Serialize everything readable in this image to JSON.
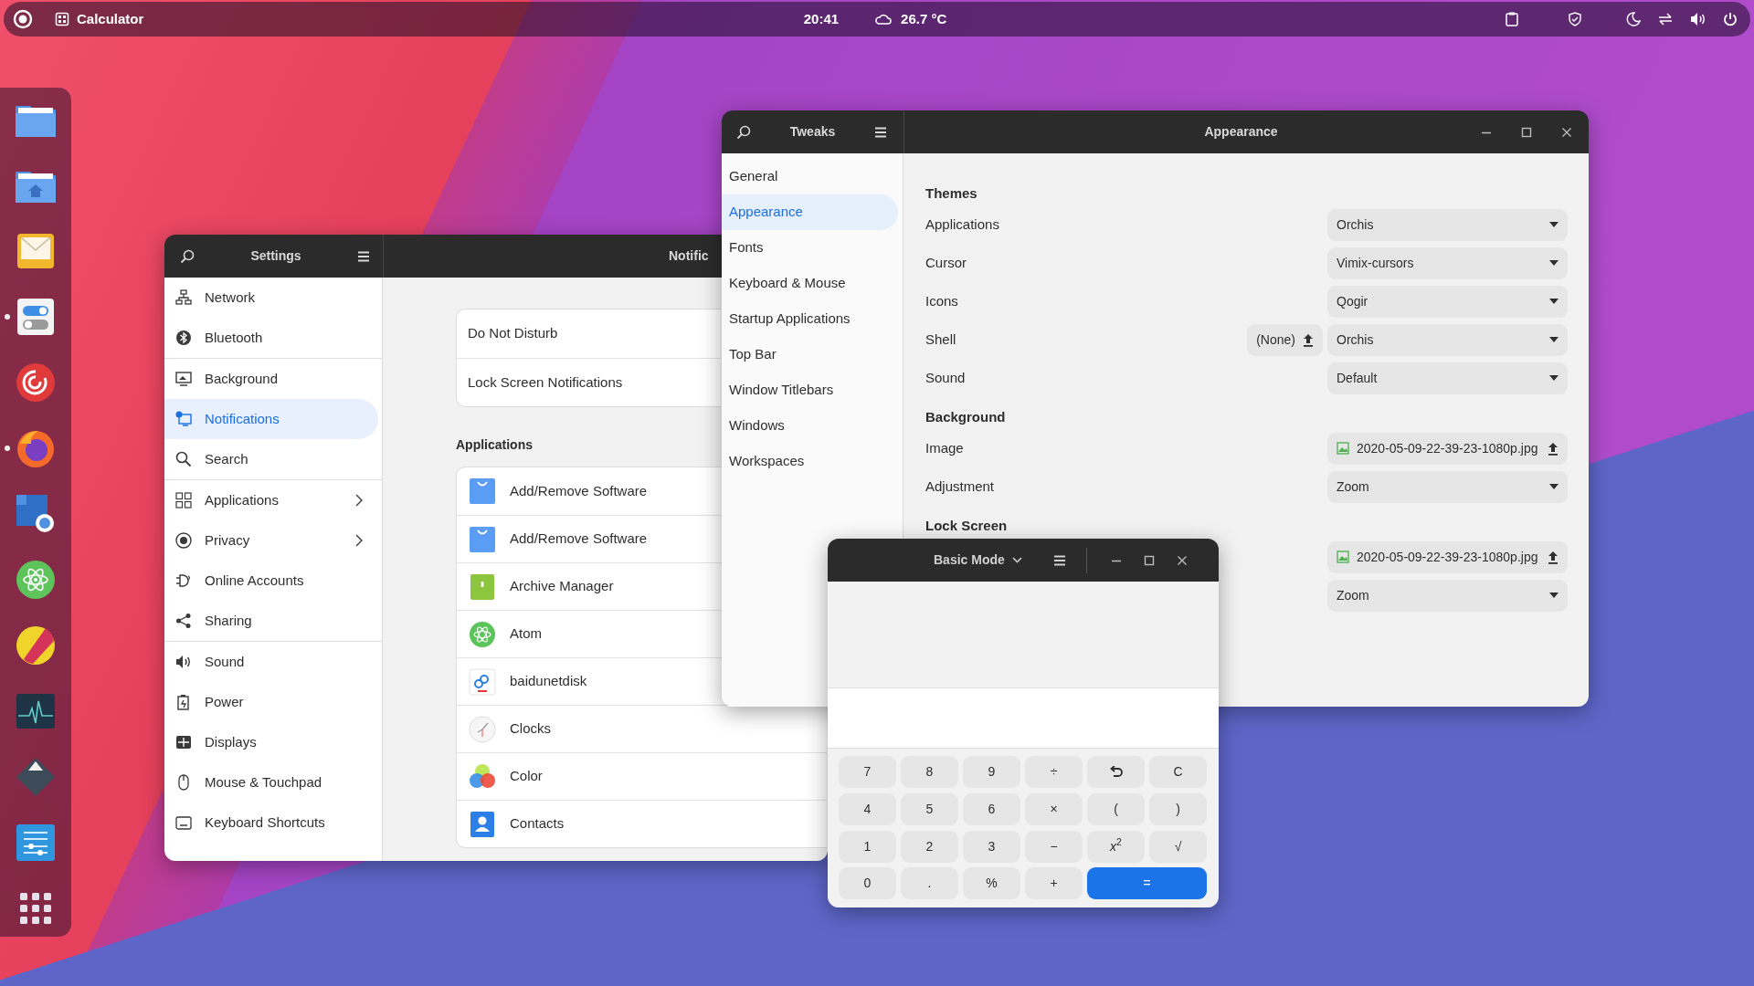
{
  "top_bar": {
    "app_name": "Calculator",
    "clock": "20:41",
    "weather": "26.7 °C"
  },
  "dock": {
    "items": [
      {
        "running": false
      },
      {
        "running": false
      },
      {
        "running": false
      },
      {
        "running": true
      },
      {
        "running": false
      },
      {
        "running": true
      },
      {
        "running": false
      },
      {
        "running": false
      },
      {
        "running": false
      },
      {
        "running": false
      },
      {
        "running": false
      },
      {
        "running": false
      }
    ]
  },
  "settings": {
    "title": "Settings",
    "page_title": "Notific",
    "sidebar": {
      "groups": [
        [
          {
            "label": "Network",
            "selected": false,
            "submenu": false
          },
          {
            "label": "Bluetooth",
            "selected": false,
            "submenu": false
          }
        ],
        [
          {
            "label": "Background",
            "selected": false,
            "submenu": false
          },
          {
            "label": "Notifications",
            "selected": true,
            "submenu": false
          },
          {
            "label": "Search",
            "selected": false,
            "submenu": false
          }
        ],
        [
          {
            "label": "Applications",
            "selected": false,
            "submenu": true
          },
          {
            "label": "Privacy",
            "selected": false,
            "submenu": true
          },
          {
            "label": "Online Accounts",
            "selected": false,
            "submenu": false
          },
          {
            "label": "Sharing",
            "selected": false,
            "submenu": false
          }
        ],
        [
          {
            "label": "Sound",
            "selected": false,
            "submenu": false
          },
          {
            "label": "Power",
            "selected": false,
            "submenu": false
          },
          {
            "label": "Displays",
            "selected": false,
            "submenu": false
          },
          {
            "label": "Mouse & Touchpad",
            "selected": false,
            "submenu": false
          },
          {
            "label": "Keyboard Shortcuts",
            "selected": false,
            "submenu": false
          }
        ]
      ]
    },
    "general_rows": [
      "Do Not Disturb",
      "Lock Screen Notifications"
    ],
    "applications_heading": "Applications",
    "applications": [
      "Add/Remove Software",
      "Add/Remove Software",
      "Archive Manager",
      "Atom",
      "baidunetdisk",
      "Clocks",
      "Color",
      "Contacts"
    ]
  },
  "tweaks": {
    "title": "Tweaks",
    "page_title": "Appearance",
    "sidebar": [
      {
        "label": "General",
        "selected": false
      },
      {
        "label": "Appearance",
        "selected": true
      },
      {
        "label": "Fonts",
        "selected": false
      },
      {
        "label": "Keyboard & Mouse",
        "selected": false
      },
      {
        "label": "Startup Applications",
        "selected": false
      },
      {
        "label": "Top Bar",
        "selected": false
      },
      {
        "label": "Window Titlebars",
        "selected": false
      },
      {
        "label": "Windows",
        "selected": false
      },
      {
        "label": "Workspaces",
        "selected": false
      }
    ],
    "sections": [
      {
        "heading": "Themes",
        "rows": [
          {
            "kind": "dropdown",
            "label": "Applications",
            "value": "Orchis"
          },
          {
            "kind": "dropdown",
            "label": "Cursor",
            "value": "Vimix-cursors"
          },
          {
            "kind": "dropdown",
            "label": "Icons",
            "value": "Qogir"
          },
          {
            "kind": "dropdown",
            "label": "Shell",
            "value": "Orchis",
            "extra": "(None)"
          },
          {
            "kind": "dropdown",
            "label": "Sound",
            "value": "Default"
          }
        ]
      },
      {
        "heading": "Background",
        "rows": [
          {
            "kind": "file",
            "label": "Image",
            "value": "2020-05-09-22-39-23-1080p.jpg"
          },
          {
            "kind": "dropdown",
            "label": "Adjustment",
            "value": "Zoom"
          }
        ]
      },
      {
        "heading": "Lock Screen",
        "rows": [
          {
            "kind": "file",
            "value": "2020-05-09-22-39-23-1080p.jpg"
          },
          {
            "kind": "dropdown",
            "value": "Zoom"
          }
        ]
      }
    ]
  },
  "calculator": {
    "mode": "Basic Mode",
    "keys": [
      {
        "label": "7"
      },
      {
        "label": "8"
      },
      {
        "label": "9"
      },
      {
        "label": "÷"
      },
      {
        "kind": "undo"
      },
      {
        "label": "C"
      },
      {
        "label": "4"
      },
      {
        "label": "5"
      },
      {
        "label": "6"
      },
      {
        "label": "×"
      },
      {
        "label": "("
      },
      {
        "label": ")"
      },
      {
        "label": "1"
      },
      {
        "label": "2"
      },
      {
        "label": "3"
      },
      {
        "label": "−"
      },
      {
        "label": "*x*$^{2}$"
      },
      {
        "label": "√"
      },
      {
        "label": "0"
      },
      {
        "label": "."
      },
      {
        "label": "%"
      },
      {
        "label": "+"
      },
      {
        "label": "=",
        "kind": "primary"
      }
    ]
  }
}
